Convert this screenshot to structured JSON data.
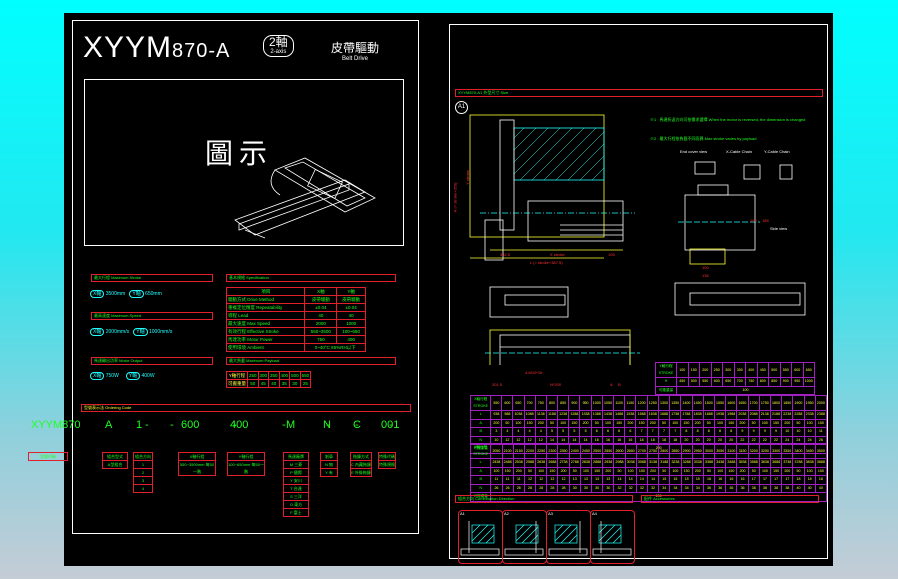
{
  "title": {
    "model": "XYYM",
    "model_num": "870-A",
    "axis_cn": "2軸",
    "axis_en": "2-axis",
    "drive_cn": "皮帶驅動",
    "drive_en": "Belt Drive"
  },
  "image_label": "圖示",
  "left": {
    "max_stroke": {
      "header": "最大行程 Maximum Stroke",
      "x": "X軸",
      "x_val": "3500mm",
      "y": "Y軸",
      "y_val": "650mm"
    },
    "max_speed": {
      "header": "最高速度 Maximum Speed",
      "x": "X軸",
      "x_val": "2000mm/s",
      "y": "Y軸",
      "y_val": "1000mm/s"
    },
    "motor": {
      "header": "馬達輸出功率 Motor Output",
      "x": "X軸",
      "x_val": "750W",
      "y": "Y軸",
      "y_val": "400W"
    },
    "spec": {
      "header": "基本規格 Specification",
      "cols": [
        "項目",
        "X軸",
        "Y軸"
      ],
      "rows": [
        [
          "驅動方式 Drive Method",
          "皮帶驅動",
          "皮帶驅動"
        ],
        [
          "重複定位精度 Repeatability",
          "±0.04",
          "±0.04"
        ],
        [
          "導程 Lead",
          "40",
          "40"
        ],
        [
          "最大速度 Max Speed",
          "2000",
          "1000"
        ],
        [
          "有效行程 Effective Stroke",
          "550~3500",
          "100~650"
        ],
        [
          "馬達功率 Motor Power",
          "750",
          "400"
        ],
        [
          "使用環境 Ambient",
          "0~40°C 85%RH以下",
          ""
        ]
      ]
    },
    "payload": {
      "header": "最大負載 Maximum Payload",
      "row1_label": "Y軸行程",
      "row1": [
        "250",
        "300",
        "350",
        "400",
        "500",
        "650"
      ],
      "row2_label": "可搬重量",
      "row2": [
        "50",
        "45",
        "40",
        "35",
        "30",
        "25"
      ]
    },
    "order": {
      "header": "型號表示法 Ordering Code",
      "code": [
        "XYYM870",
        "A",
        "1",
        "600",
        "400",
        "M",
        "N",
        "C",
        "001"
      ],
      "seps": [
        "-",
        "-",
        "-",
        "-",
        "-",
        "-",
        "-"
      ],
      "labels": [
        "型號代碼",
        "組合型式",
        "組合方向",
        "X軸行程",
        "Y軸行程",
        "馬達廠牌",
        "剎車",
        "拖鍊方式",
        "特殊代碼"
      ],
      "opts": {
        "type": [
          "A型組合"
        ],
        "dir": [
          "1",
          "2",
          "3",
          "4"
        ],
        "x": [
          "550~3500mm 每50一階"
        ],
        "y": [
          "100~650mm 每50一階"
        ],
        "motor": [
          "M 三菱",
          "P 國際",
          "Y 安川",
          "T 台達",
          "S 三洋",
          "O 東方",
          "F 富士"
        ],
        "brake": [
          "N 無",
          "Y 有"
        ],
        "chain": [
          "C 內藏拖鍊",
          "E 外掛拖鍊"
        ],
        "special": [
          "特殊規格"
        ]
      }
    }
  },
  "right": {
    "dim_header": "XYYM870-A1 外型尺寸 Size",
    "view_tag": "A1",
    "note1": "※1 : 馬達折返方向可依需求選擇 When the motor is reversed, the dimension is changed",
    "note2": "※2 : 最大行程依負載不同而異 Max stroke varies by payload",
    "end_view": "End cover view",
    "x_chain": "X-Cable Chain",
    "y_chain": "Y-Cable Chain",
    "side_view": "Side view",
    "dims": {
      "d1": "332.5",
      "xstroke": "X stroke",
      "d2": "105",
      "L": "L (= stroke+387.5)",
      "d3": "201.5",
      "nx": "N*200",
      "A": "A",
      "B": "B",
      "ystroke": "Y stroke",
      "H": "H (= stroke+350)",
      "m": "4-M10*16",
      "d4": "100",
      "d5": "136",
      "d6": "190",
      "d7": "185"
    },
    "y_table": {
      "h1": "Y軸行程 STROKE",
      "h2": "H",
      "h3": "可搬重量",
      "stroke": [
        "100",
        "150",
        "200",
        "250",
        "300",
        "350",
        "400",
        "450",
        "500",
        "550",
        "600",
        "650"
      ],
      "H": [
        "450",
        "500",
        "550",
        "600",
        "650",
        "700",
        "750",
        "800",
        "850",
        "900",
        "950",
        "1000"
      ],
      "w": "100"
    },
    "x_table1": {
      "h": [
        "X軸行程 STROKE",
        "L",
        "A",
        "B",
        "N",
        "可搬重量"
      ],
      "stroke": [
        "550",
        "600",
        "650",
        "700",
        "750",
        "800",
        "850",
        "900",
        "950",
        "1000",
        "1050",
        "1100",
        "1150",
        "1200",
        "1250",
        "1300",
        "1350",
        "1400",
        "1450",
        "1500",
        "1550",
        "1600",
        "1650",
        "1700",
        "1750",
        "1800",
        "1850",
        "1900",
        "1950",
        "2000"
      ],
      "L": [
        "938",
        "988",
        "1038",
        "1088",
        "1138",
        "1188",
        "1238",
        "1288",
        "1338",
        "1388",
        "1438",
        "1488",
        "1538",
        "1588",
        "1638",
        "1688",
        "1738",
        "1788",
        "1838",
        "1888",
        "1938",
        "1988",
        "2038",
        "2088",
        "2138",
        "2188",
        "2238",
        "2288",
        "2338",
        "2388"
      ],
      "A": [
        "200",
        "50",
        "100",
        "150",
        "200",
        "50",
        "100",
        "150",
        "200",
        "50",
        "100",
        "150",
        "200",
        "150",
        "200",
        "50",
        "100",
        "150",
        "200",
        "50",
        "100",
        "150",
        "200",
        "50",
        "100",
        "150",
        "200",
        "50",
        "100",
        "150"
      ],
      "B": [
        "3",
        "4",
        "4",
        "4",
        "4",
        "5",
        "5",
        "5",
        "5",
        "6",
        "6",
        "6",
        "6",
        "7",
        "7",
        "7",
        "7",
        "8",
        "8",
        "8",
        "8",
        "8",
        "9",
        "9",
        "9",
        "9",
        "10",
        "10",
        "10",
        "11"
      ],
      "N": [
        "10",
        "12",
        "12",
        "12",
        "12",
        "14",
        "14",
        "14",
        "14",
        "16",
        "16",
        "16",
        "16",
        "18",
        "18",
        "18",
        "18",
        "20",
        "20",
        "20",
        "20",
        "20",
        "22",
        "22",
        "22",
        "22",
        "24",
        "24",
        "24",
        "26"
      ],
      "w": "200"
    },
    "x_table2": {
      "stroke": [
        "2050",
        "2100",
        "2150",
        "2200",
        "2250",
        "2300",
        "2350",
        "2400",
        "2450",
        "2500",
        "2550",
        "2600",
        "2650",
        "2700",
        "2750",
        "2800",
        "2850",
        "2900",
        "2950",
        "3000",
        "3050",
        "3100",
        "3150",
        "3200",
        "3250",
        "3300",
        "3350",
        "3400",
        "3450",
        "3500"
      ],
      "L": [
        "2438",
        "2488",
        "2538",
        "2588",
        "2638",
        "2688",
        "2738",
        "2788",
        "2838",
        "2888",
        "2938",
        "2988",
        "3038",
        "3088",
        "3138",
        "3188",
        "3238",
        "3288",
        "3338",
        "3388",
        "3438",
        "3488",
        "3538",
        "3588",
        "3638",
        "3688",
        "3738",
        "3788",
        "3838",
        "3888"
      ],
      "A": [
        "100",
        "150",
        "200",
        "50",
        "100",
        "150",
        "200",
        "50",
        "100",
        "150",
        "200",
        "50",
        "100",
        "150",
        "200",
        "50",
        "100",
        "150",
        "200",
        "50",
        "100",
        "150",
        "200",
        "50",
        "100",
        "150",
        "200",
        "50",
        "100",
        "150"
      ],
      "B": [
        "11",
        "11",
        "11",
        "12",
        "12",
        "12",
        "12",
        "13",
        "13",
        "13",
        "13",
        "14",
        "14",
        "14",
        "14",
        "15",
        "15",
        "15",
        "15",
        "16",
        "16",
        "16",
        "16",
        "17",
        "17",
        "17",
        "17",
        "18",
        "18",
        "18"
      ],
      "N": [
        "26",
        "26",
        "26",
        "28",
        "28",
        "28",
        "28",
        "30",
        "30",
        "30",
        "30",
        "32",
        "32",
        "32",
        "32",
        "34",
        "34",
        "34",
        "34",
        "36",
        "36",
        "36",
        "36",
        "38",
        "38",
        "38",
        "38",
        "40",
        "40",
        "40"
      ],
      "w": "200"
    },
    "combo_header": "組合方向 Combination Direction",
    "combo_tags": [
      "A1",
      "A2",
      "A3",
      "A4"
    ],
    "acc_header": "配件 Accessories"
  },
  "colors": {
    "bg_canvas": "#000000",
    "frame": "#ffffff",
    "red": "#e0202a",
    "green": "#20ff20",
    "cyan": "#20ffff",
    "yellow": "#ffff20",
    "purple": "#a020c0"
  }
}
